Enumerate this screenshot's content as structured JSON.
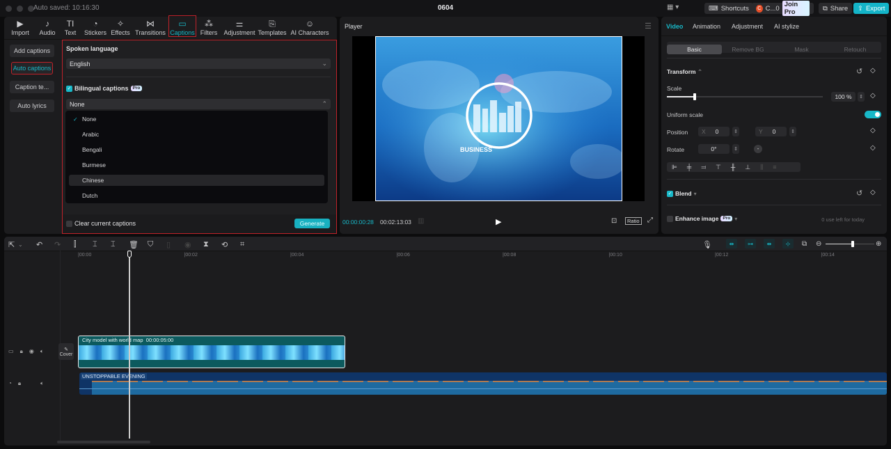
{
  "titlebar": {
    "autosave": "Auto saved: 10:16:30",
    "project_title": "0604",
    "layout_icon": "layout-icon",
    "shortcuts": "Shortcuts",
    "user": "C...0",
    "user_initial": "C",
    "join_pro": "Join Pro",
    "share": "Share",
    "export": "Export"
  },
  "toolbar": {
    "tabs": [
      {
        "label": "Import",
        "icon": "▶"
      },
      {
        "label": "Audio",
        "icon": "♪"
      },
      {
        "label": "Text",
        "icon": "TI"
      },
      {
        "label": "Stickers",
        "icon": "◔"
      },
      {
        "label": "Effects",
        "icon": "✧"
      },
      {
        "label": "Transitions",
        "icon": "⋈"
      },
      {
        "label": "Captions",
        "icon": "▭"
      },
      {
        "label": "Filters",
        "icon": "⁂"
      },
      {
        "label": "Adjustment",
        "icon": "⚌"
      },
      {
        "label": "Templates",
        "icon": "⎘"
      },
      {
        "label": "AI Characters",
        "icon": "☺"
      }
    ],
    "active": "Captions"
  },
  "caption_nav": [
    "Add captions",
    "Auto captions",
    "Caption te...",
    "Auto lyrics"
  ],
  "caption_nav_active": "Auto captions",
  "auto_captions": {
    "spoken_language_label": "Spoken language",
    "spoken_language_value": "English",
    "bilingual_label": "Bilingual captions",
    "bilingual_checked": true,
    "pro_badge": "Pro",
    "bilingual_value": "None",
    "dropdown_options": [
      "None",
      "Arabic",
      "Bengali",
      "Burmese",
      "Chinese",
      "Dutch"
    ],
    "selected_option": "None",
    "hovered_option": "Chinese",
    "clear_label": "Clear current captions",
    "clear_checked": false,
    "generate": "Generate"
  },
  "player": {
    "title": "Player",
    "video_text": "BUSINESS",
    "current_time": "00:00:00:28",
    "total_time": "00:02:13:03",
    "ratio": "Ratio"
  },
  "inspector": {
    "tabs": [
      "Video",
      "Animation",
      "Adjustment",
      "AI stylize"
    ],
    "active_tab": "Video",
    "subtabs": [
      "Basic",
      "Remove BG",
      "Mask",
      "Retouch"
    ],
    "active_subtab": "Basic",
    "transform_label": "Transform",
    "scale_label": "Scale",
    "scale_value": "100 %",
    "scale_fraction": 0.18,
    "uniform_scale_label": "Uniform scale",
    "uniform_scale_on": true,
    "position_label": "Position",
    "x_label": "X",
    "x_value": "0",
    "y_label": "Y",
    "y_value": "0",
    "rotate_label": "Rotate",
    "rotate_value": "0°",
    "blend_label": "Blend",
    "blend_checked": true,
    "enhance_label": "Enhance image",
    "enhance_checked": false,
    "enhance_note": "0 use left for today"
  },
  "timeline": {
    "ruler": [
      "|00:00",
      "|00:02",
      "|00:04",
      "|00:06",
      "|00:08",
      "|00:10",
      "|00:12",
      "|00:14"
    ],
    "cover_label": "Cover",
    "video_clip_name": "City model with world map",
    "video_clip_duration": "00:00:05:00",
    "audio_clip_name": "UNSTOPPABLE EVENING",
    "zoom_fraction": 0.55
  }
}
